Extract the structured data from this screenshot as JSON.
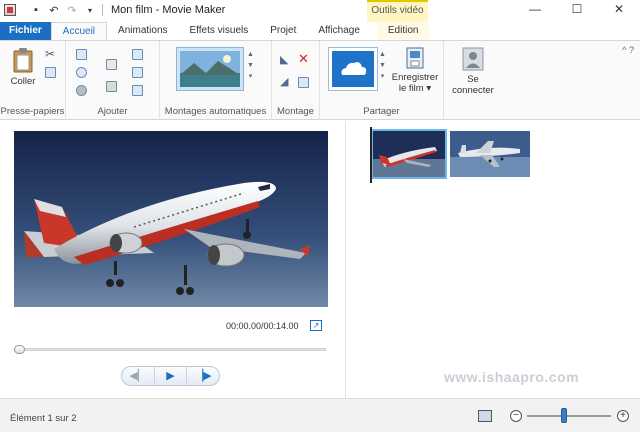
{
  "window": {
    "title": "Mon film - Movie Maker",
    "context_tab_group": "Outils vidéo",
    "controls": {
      "minimize": "—",
      "maximize": "☐",
      "close": "✕"
    }
  },
  "tabs": [
    {
      "label": "Fichier",
      "kind": "file"
    },
    {
      "label": "Accueil",
      "kind": "active"
    },
    {
      "label": "Animations",
      "kind": "normal"
    },
    {
      "label": "Effets visuels",
      "kind": "normal"
    },
    {
      "label": "Projet",
      "kind": "normal"
    },
    {
      "label": "Affichage",
      "kind": "normal"
    },
    {
      "label": "Edition",
      "kind": "context"
    }
  ],
  "ribbon": {
    "clipboard": {
      "paste_label": "Coller",
      "group_label": "Presse-papiers"
    },
    "add": {
      "group_label": "Ajouter"
    },
    "automovie": {
      "group_label": "Montages automatiques"
    },
    "editing": {
      "group_label": "Montage"
    },
    "share": {
      "save_label": "Enregistrer",
      "save_label2": "le film ▾",
      "group_label": "Partager"
    },
    "signin": {
      "label": "Se",
      "label2": "connecter"
    }
  },
  "player": {
    "timecode": "00:00.00/00:14.00",
    "progress": 0.0
  },
  "storyboard": {
    "clips": 2,
    "selected_clip": 1
  },
  "watermark": "www.ishaapro.com",
  "status": {
    "text": "Élément 1 sur 2",
    "zoom_level": 0.4
  },
  "colors": {
    "accent": "#1a6fc2",
    "context_tab": "#fff6c2",
    "sky_top": "#1b2a55",
    "sky_bottom": "#6d87a8"
  }
}
